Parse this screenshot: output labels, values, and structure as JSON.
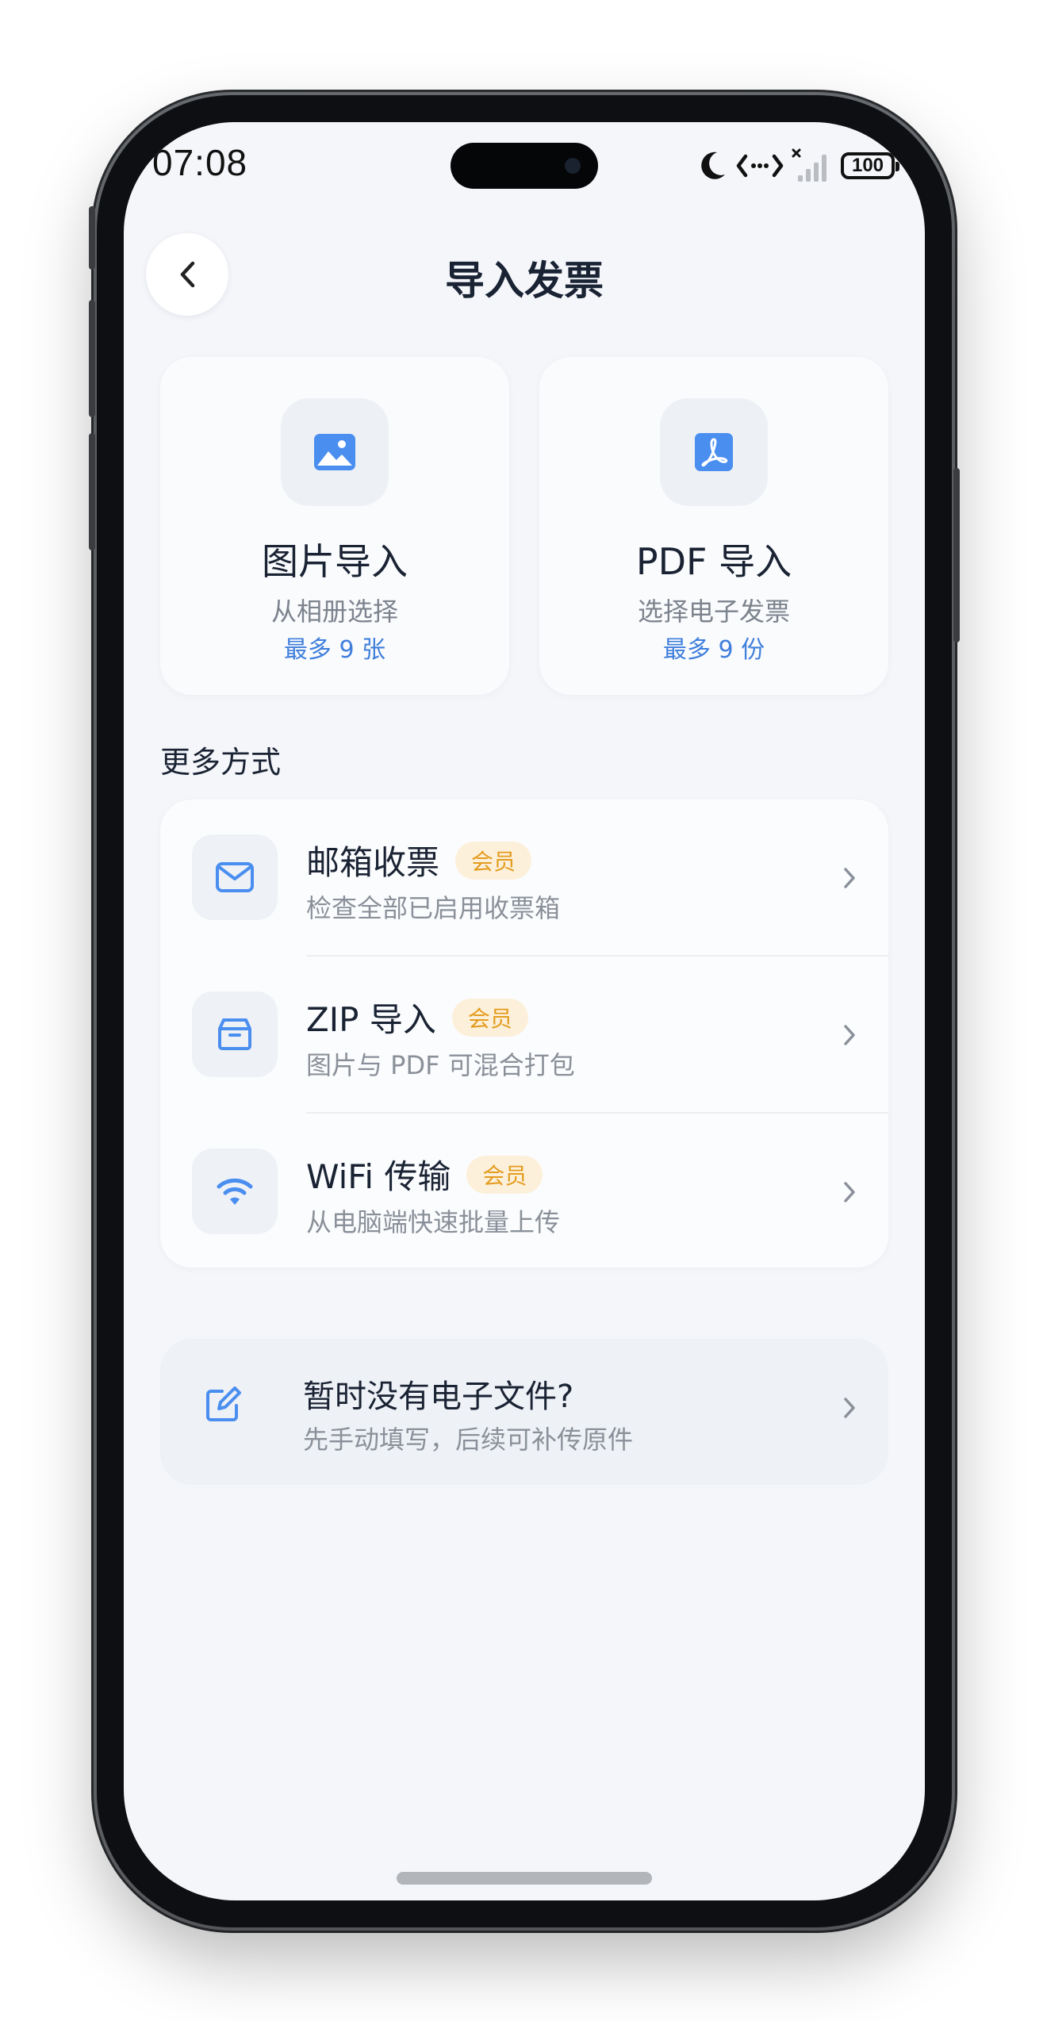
{
  "status": {
    "time": "07:08",
    "battery": "100"
  },
  "header": {
    "title": "导入发票"
  },
  "cards": [
    {
      "title": "图片导入",
      "subtitle": "从相册选择",
      "limit": "最多 9 张",
      "icon": "image-icon"
    },
    {
      "title": "PDF 导入",
      "subtitle": "选择电子发票",
      "limit": "最多 9 份",
      "icon": "pdf-icon"
    }
  ],
  "more": {
    "title": "更多方式",
    "items": [
      {
        "title": "邮箱收票",
        "badge": "会员",
        "subtitle": "检查全部已启用收票箱",
        "icon": "mail-icon"
      },
      {
        "title": "ZIP 导入",
        "badge": "会员",
        "subtitle": "图片与 PDF 可混合打包",
        "icon": "archive-icon"
      },
      {
        "title": "WiFi 传输",
        "badge": "会员",
        "subtitle": "从电脑端快速批量上传",
        "icon": "wifi-icon"
      }
    ]
  },
  "manual": {
    "title": "暂时没有电子文件?",
    "subtitle": "先手动填写，后续可补传原件",
    "icon": "edit-icon"
  },
  "colors": {
    "accent": "#3f7fdc",
    "badge_bg": "#fdf0da",
    "badge_text": "#e39c1e"
  }
}
